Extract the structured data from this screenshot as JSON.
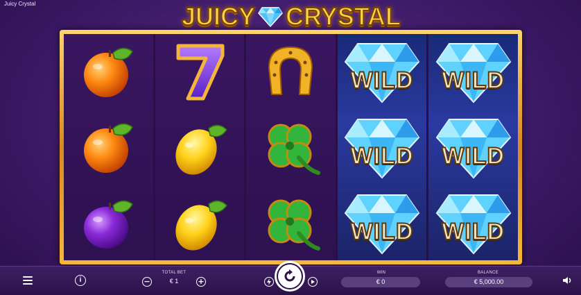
{
  "app": {
    "game_title": "Juicy Crystal",
    "logo_left": "JUICY",
    "logo_right": "CRYSTAL"
  },
  "reels": [
    [
      "orange",
      "orange",
      "plum"
    ],
    [
      "seven",
      "lemon",
      "lemon"
    ],
    [
      "horseshoe",
      "clover",
      "clover"
    ],
    [
      "wild",
      "wild",
      "wild"
    ],
    [
      "wild",
      "wild",
      "wild"
    ]
  ],
  "symbols": {
    "wild_label": "WILD"
  },
  "controls": {
    "total_bet_label": "TOTAL BET",
    "total_bet_value": "€ 1",
    "win_label": "WIN",
    "win_value": "€ 0",
    "balance_label": "BALANCE",
    "balance_value": "€ 5,000.00",
    "minus": "−",
    "plus": "+",
    "info": "i"
  },
  "icons": {
    "menu": "hamburger-menu-icon",
    "info": "info-icon",
    "bet_decrease": "minus-circle-icon",
    "bet_increase": "plus-circle-icon",
    "turbo": "lightning-icon",
    "spin": "refresh-spin-icon",
    "autoplay": "autoplay-icon",
    "sound": "speaker-icon"
  },
  "colors": {
    "background": "#3e1b68",
    "frame_gold": "#e8a530",
    "wild_reel": "#2a3aa0",
    "logo_yellow": "#ffd54a",
    "pill": "#5a3f7f"
  }
}
